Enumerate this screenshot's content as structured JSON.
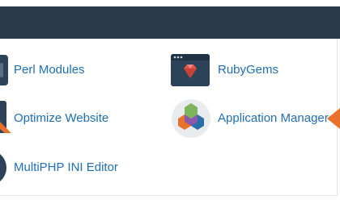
{
  "tools": {
    "perl_modules": "Perl Modules",
    "ruby_gems": "RubyGems",
    "optimize_website": "Optimize Website",
    "application_manager": "Application Manager",
    "multiphp_ini_editor": "MultiPHP INI Editor"
  },
  "colors": {
    "header": "#293a4a",
    "link": "#1f6fb2",
    "accent_orange": "#e8722c"
  }
}
